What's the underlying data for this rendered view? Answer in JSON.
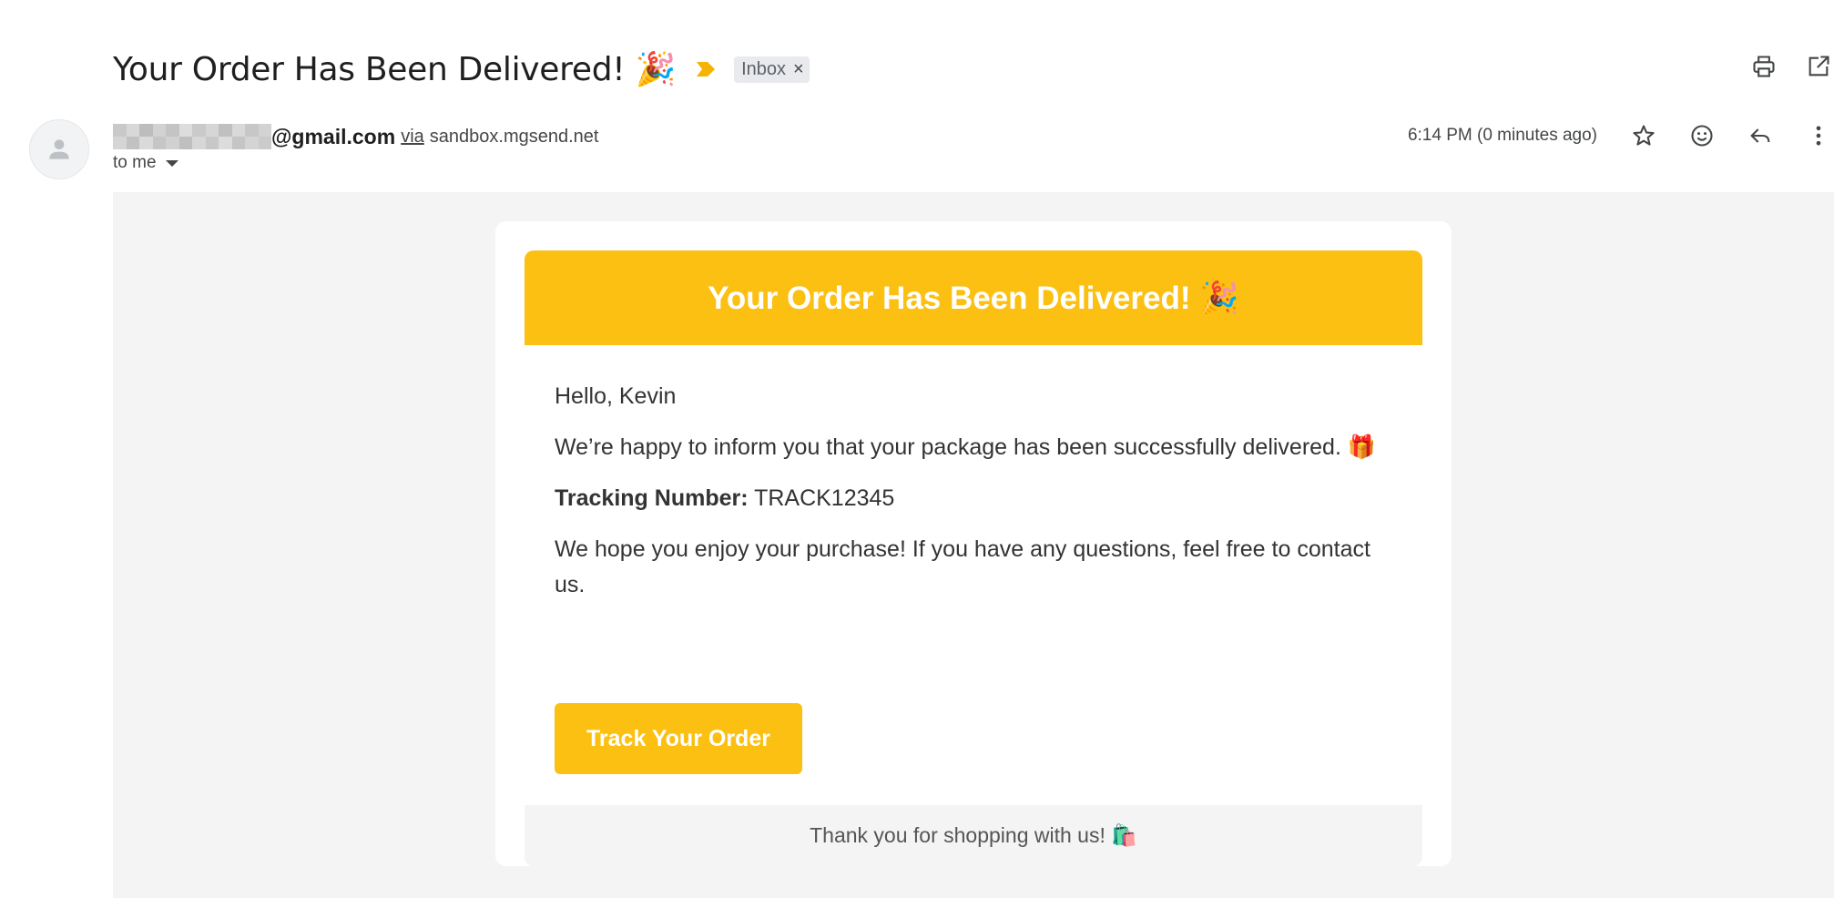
{
  "email": {
    "subject": "Your Order Has Been Delivered! 🎉",
    "label": "Inbox",
    "label_remove": "×",
    "sender": {
      "email_suffix": "@gmail.com",
      "via_text": "via",
      "via_domain": "sandbox.mgsend.net"
    },
    "recipient": "to me",
    "timestamp": "6:14 PM (0 minutes ago)",
    "icons": {
      "importance": "importance-marker-icon",
      "print": "print-icon",
      "open_new_window": "open-in-new-window-icon",
      "star": "star-icon",
      "emoji_react": "emoji-reaction-icon",
      "reply": "reply-icon",
      "more": "more-options-icon",
      "avatar": "default-avatar-icon"
    }
  },
  "message": {
    "banner_title": "Your Order Has Been Delivered! 🎉",
    "greeting": "Hello, Kevin",
    "intro": "We’re happy to inform you that your package has been successfully delivered. 🎁",
    "tracking_label": "Tracking Number:",
    "tracking_number": "TRACK12345",
    "closing": "We hope you enjoy your purchase! If you have any questions, feel free to contact us.",
    "cta_label": "Track Your Order",
    "footer": "Thank you for shopping with us! 🛍️"
  },
  "colors": {
    "accent_yellow": "#fbc012",
    "body_background": "#f4f4f4",
    "label_chip": "#e8eaed",
    "importance_marker": "#f4b400"
  }
}
